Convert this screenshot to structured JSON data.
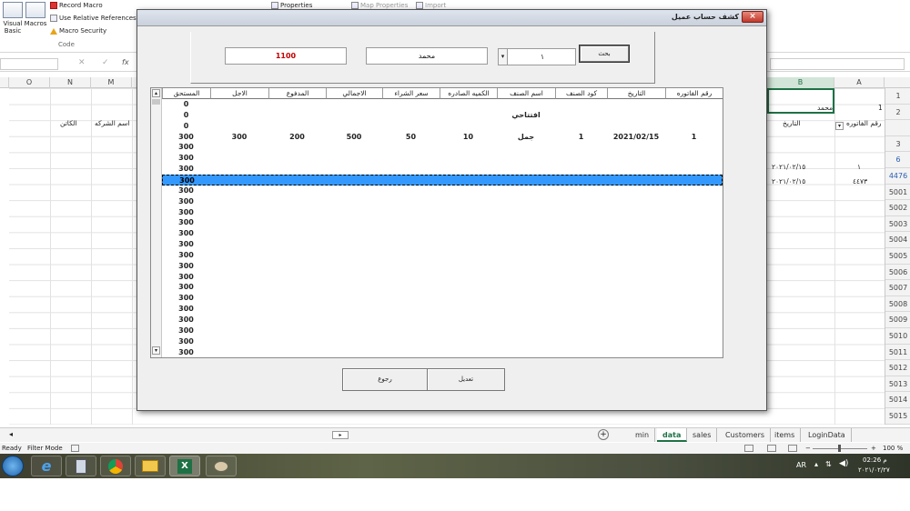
{
  "ribbon": {
    "visual_basic": "Visual\nBasic",
    "macros": "Macros",
    "record_macro": "Record Macro",
    "use_relative": "Use Relative References",
    "macro_security": "Macro Security",
    "group_code": "Code",
    "properties": "Properties",
    "map_properties": "Map Properties",
    "import": "Import"
  },
  "columns_left": [
    "O",
    "N",
    "M"
  ],
  "columns_right": [
    "B",
    "A"
  ],
  "sheet_cells": {
    "n_header": "الكاتن",
    "m_header": "اسم الشركه",
    "b1": "محمد",
    "a1": "1",
    "b2": "التاريخ",
    "a2": "رقم الفاتوره",
    "b5": "٢٠٢١/٠٢/١٥",
    "a5": "١",
    "b6": "٢٠٢١/٠٢/١٥",
    "a6": "٤٤٧٣"
  },
  "row_numbers": [
    "1",
    "2",
    "",
    "3",
    "6",
    "4476",
    "5001",
    "5002",
    "5003",
    "5004",
    "5005",
    "5006",
    "5007",
    "5008",
    "5009",
    "5010",
    "5011",
    "5012",
    "5013",
    "5014",
    "5015"
  ],
  "sheet_tabs": [
    "min",
    "data",
    "sales",
    "Customers",
    "items",
    "LoginData"
  ],
  "active_tab": "data",
  "status": {
    "ready": "Ready",
    "filter_mode": "Filter Mode",
    "zoom": "100 %"
  },
  "taskbar": {
    "lang": "AR",
    "time": "02:26 م",
    "date": "٢٠٢١/٠٢/٢٧"
  },
  "dialog": {
    "title": "كشف حساب عميل",
    "close": "×",
    "search_button": "بحث",
    "search_value": "١",
    "customer_name": "محمد",
    "balance_value": "1100",
    "edit_button": "تعديل",
    "back_button": "رجوع",
    "columns": [
      "رقم الفاتوره",
      "التاريخ",
      "كود الصنف",
      "اسم الصنف",
      "الكميه الصادره",
      "سعر الشراء",
      "الاجمالي",
      "المدفوع",
      "الاجل",
      "المستحق"
    ],
    "rows": [
      [
        "",
        "",
        "",
        "",
        "",
        "",
        "",
        "",
        "",
        "0"
      ],
      [
        "",
        "",
        "",
        "افتتاحي",
        "",
        "",
        "",
        "",
        "",
        "0"
      ],
      [
        "",
        "",
        "",
        "",
        "",
        "",
        "",
        "",
        "",
        "0"
      ],
      [
        "1",
        "2021/02/15",
        "1",
        "جمل",
        "10",
        "50",
        "500",
        "200",
        "300",
        "300"
      ],
      [
        "",
        "",
        "",
        "",
        "",
        "",
        "",
        "",
        "",
        "300"
      ],
      [
        "",
        "",
        "",
        "",
        "",
        "",
        "",
        "",
        "",
        "300"
      ],
      [
        "",
        "",
        "",
        "",
        "",
        "",
        "",
        "",
        "",
        "300"
      ],
      [
        "",
        "",
        "",
        "",
        "",
        "",
        "",
        "",
        "",
        "300"
      ],
      [
        "",
        "",
        "",
        "",
        "",
        "",
        "",
        "",
        "",
        "300"
      ],
      [
        "",
        "",
        "",
        "",
        "",
        "",
        "",
        "",
        "",
        "300"
      ],
      [
        "",
        "",
        "",
        "",
        "",
        "",
        "",
        "",
        "",
        "300"
      ],
      [
        "",
        "",
        "",
        "",
        "",
        "",
        "",
        "",
        "",
        "300"
      ],
      [
        "",
        "",
        "",
        "",
        "",
        "",
        "",
        "",
        "",
        "300"
      ],
      [
        "",
        "",
        "",
        "",
        "",
        "",
        "",
        "",
        "",
        "300"
      ],
      [
        "",
        "",
        "",
        "",
        "",
        "",
        "",
        "",
        "",
        "300"
      ],
      [
        "",
        "",
        "",
        "",
        "",
        "",
        "",
        "",
        "",
        "300"
      ],
      [
        "",
        "",
        "",
        "",
        "",
        "",
        "",
        "",
        "",
        "300"
      ],
      [
        "",
        "",
        "",
        "",
        "",
        "",
        "",
        "",
        "",
        "300"
      ],
      [
        "",
        "",
        "",
        "",
        "",
        "",
        "",
        "",
        "",
        "300"
      ],
      [
        "",
        "",
        "",
        "",
        "",
        "",
        "",
        "",
        "",
        "300"
      ],
      [
        "",
        "",
        "",
        "",
        "",
        "",
        "",
        "",
        "",
        "300"
      ],
      [
        "",
        "",
        "",
        "",
        "",
        "",
        "",
        "",
        "",
        "300"
      ],
      [
        "",
        "",
        "",
        "",
        "",
        "",
        "",
        "",
        "",
        "300"
      ],
      [
        "",
        "",
        "",
        "",
        "",
        "",
        "",
        "",
        "",
        "300"
      ]
    ],
    "selected_row": 7
  },
  "colors": {
    "accent_selection": "#3399ff",
    "balance_red": "#c00000",
    "excel_green": "#1e7145"
  }
}
